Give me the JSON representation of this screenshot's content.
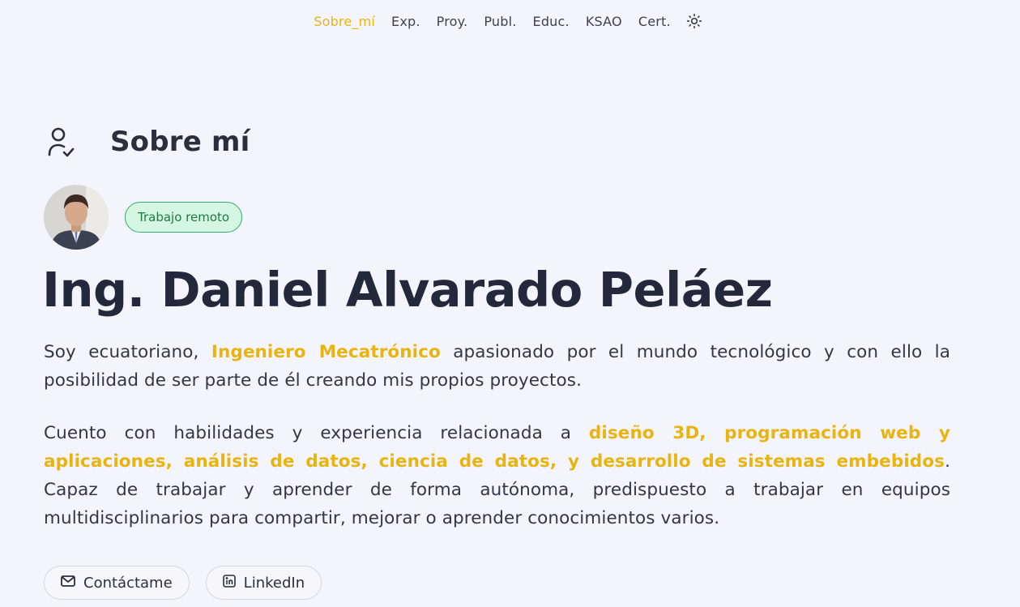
{
  "nav": {
    "items": [
      {
        "label": "Sobre_mí",
        "active": true
      },
      {
        "label": "Exp."
      },
      {
        "label": "Proy."
      },
      {
        "label": "Publ."
      },
      {
        "label": "Educ."
      },
      {
        "label": "KSAO"
      },
      {
        "label": "Cert."
      }
    ],
    "theme_icon": "sun-icon"
  },
  "section": {
    "icon": "user-check-icon",
    "title": "Sobre mí"
  },
  "profile": {
    "avatar_icon": "profile-photo",
    "badge": "Trabajo remoto",
    "name": "Ing. Daniel Alvarado Peláez"
  },
  "bio": {
    "p1_pre": "Soy ecuatoriano, ",
    "p1_highlight": "Ingeniero Mecatrónico",
    "p1_post": " apasionado por el mundo tecnológico y con ello la posibilidad de ser parte de él creando mis propios proyectos.",
    "p2_pre": "Cuento con habilidades y experiencia relacionada a ",
    "p2_highlight": "diseño 3D, programación web y aplicaciones, análisis de datos, ciencia de datos, y desarrollo de sistemas embebidos",
    "p2_post": ". Capaz de trabajar y aprender de forma autónoma, predispuesto a trabajar en equipos multidisciplinarios para compartir, mejorar o aprender conocimientos varios."
  },
  "actions": {
    "contact_label": "Contáctame",
    "contact_icon": "mail-icon",
    "linkedin_label": "LinkedIn",
    "linkedin_icon": "linkedin-icon"
  },
  "colors": {
    "accent": "#e9b410",
    "background": "#f4f4fc",
    "badge_bg": "#d5f6e3",
    "badge_border": "#2fae6b"
  }
}
